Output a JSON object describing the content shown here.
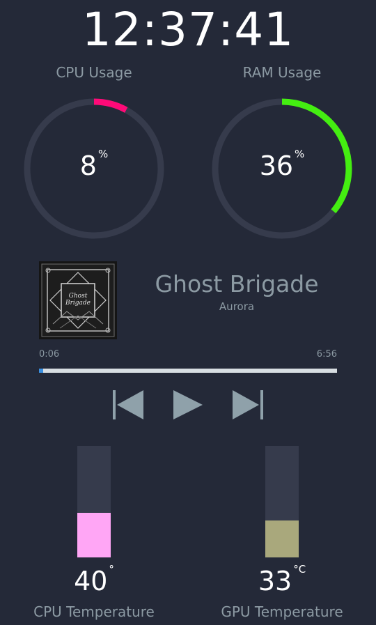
{
  "clock": {
    "time": "12:37:41"
  },
  "cpu_usage": {
    "label": "CPU Usage",
    "value": "8",
    "unit": "%",
    "percent": 8,
    "color": "#ff0a78"
  },
  "ram_usage": {
    "label": "RAM Usage",
    "value": "36",
    "unit": "%",
    "percent": 36,
    "color": "#44ee11"
  },
  "gauge_track_color": "#363b4c",
  "media": {
    "title": "Ghost Brigade",
    "artist": "Aurora",
    "album_art_text": "Ghost Brigade",
    "elapsed": "0:06",
    "duration": "6:56",
    "progress_fraction": 0.0144,
    "controls": {
      "previous_icon": "skip-previous-icon",
      "play_icon": "play-icon",
      "next_icon": "skip-next-icon",
      "color": "#8fa1aa"
    }
  },
  "cpu_temp": {
    "label": "CPU Temperature",
    "value": "40",
    "unit": "°",
    "level_fraction": 0.4,
    "color": "#ffa6f5"
  },
  "gpu_temp": {
    "label": "GPU Temperature",
    "value": "33",
    "unit": "°C",
    "level_fraction": 0.33,
    "color": "#a9a87c"
  }
}
